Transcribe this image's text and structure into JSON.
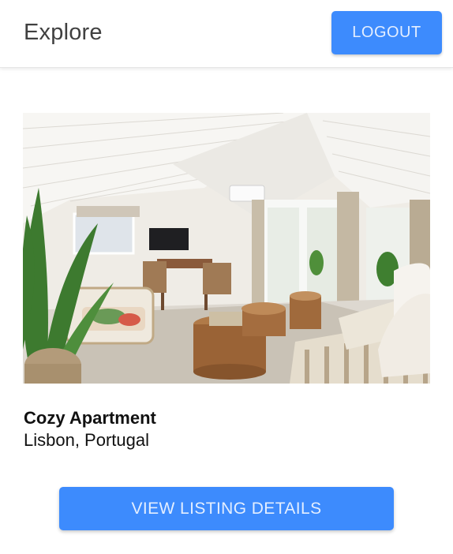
{
  "header": {
    "title": "Explore",
    "logout_label": "LOGOUT"
  },
  "listing": {
    "image_alt_icon": "apartment-photo",
    "title": "Cozy Apartment",
    "location": "Lisbon, Portugal",
    "details_label": "VIEW LISTING DETAILS"
  },
  "colors": {
    "accent": "#3d8bfd",
    "button_text": "#e3eeff"
  }
}
